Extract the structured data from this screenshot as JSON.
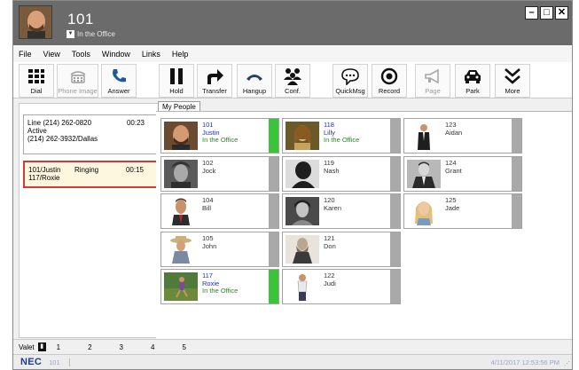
{
  "window": {
    "extension": "101",
    "status": "In the Office",
    "buttons": [
      "–",
      "□",
      "✕"
    ]
  },
  "menu": [
    "File",
    "View",
    "Tools",
    "Window",
    "Links",
    "Help"
  ],
  "toolbar": [
    {
      "label": "Dial",
      "icon": "dialpad-icon",
      "enabled": true
    },
    {
      "label": "Phone Image",
      "icon": "phone-image-icon",
      "enabled": false
    },
    {
      "label": "Answer",
      "icon": "answer-icon",
      "enabled": true
    },
    {
      "label": "Hold",
      "icon": "hold-icon",
      "enabled": true
    },
    {
      "label": "Transfer",
      "icon": "transfer-icon",
      "enabled": true
    },
    {
      "label": "Hangup",
      "icon": "hangup-icon",
      "enabled": true
    },
    {
      "label": "Conf.",
      "icon": "conference-icon",
      "enabled": true
    },
    {
      "label": "QuickMsg",
      "icon": "quickmsg-icon",
      "enabled": true
    },
    {
      "label": "Record",
      "icon": "record-icon",
      "enabled": true
    },
    {
      "label": "Page",
      "icon": "page-icon",
      "enabled": false
    },
    {
      "label": "Park",
      "icon": "park-icon",
      "enabled": true
    },
    {
      "label": "More",
      "icon": "more-icon",
      "enabled": true
    }
  ],
  "calls": {
    "active": {
      "line": "Line (214) 262-0820",
      "time": "00:23",
      "state": "Active",
      "caller": "(214) 262-3932/Dallas"
    },
    "ringing": {
      "from": "101/Justin",
      "state": "Ringing",
      "time": "00:15",
      "to": "117/Roxie"
    }
  },
  "tab": "My People",
  "contacts": [
    {
      "ext": "101",
      "name": "Justin",
      "status": "In the Office",
      "online": true,
      "bar": "green",
      "photo": "man-beard"
    },
    {
      "ext": "102",
      "name": "Jock",
      "status": "",
      "online": false,
      "bar": "gray",
      "photo": "bw-man"
    },
    {
      "ext": "104",
      "name": "Bill",
      "status": "",
      "online": false,
      "bar": "gray",
      "photo": "man-tie"
    },
    {
      "ext": "105",
      "name": "John",
      "status": "",
      "online": false,
      "bar": "gray",
      "photo": "cowboy"
    },
    {
      "ext": "117",
      "name": "Roxie",
      "status": "In the Office",
      "online": true,
      "bar": "green",
      "photo": "runner"
    },
    {
      "ext": "118",
      "name": "Lilly",
      "status": "In the Office",
      "online": true,
      "bar": "gray",
      "photo": "woman-painting"
    },
    {
      "ext": "119",
      "name": "Nash",
      "status": "",
      "online": false,
      "bar": "gray",
      "photo": "bw-silhouette"
    },
    {
      "ext": "120",
      "name": "Karen",
      "status": "",
      "online": false,
      "bar": "gray",
      "photo": "bw-woman"
    },
    {
      "ext": "121",
      "name": "Don",
      "status": "",
      "online": false,
      "bar": "gray",
      "photo": "bw-bearded"
    },
    {
      "ext": "122",
      "name": "Judi",
      "status": "",
      "online": false,
      "bar": "gray",
      "photo": "man-standing"
    },
    {
      "ext": "123",
      "name": "Aidan",
      "status": "",
      "online": false,
      "bar": "gray",
      "photo": "man-suit"
    },
    {
      "ext": "124",
      "name": "Grant",
      "status": "",
      "online": false,
      "bar": "gray",
      "photo": "bw-suit"
    },
    {
      "ext": "125",
      "name": "Jade",
      "status": "",
      "online": false,
      "bar": "gray",
      "photo": "woman-blonde"
    }
  ],
  "valet": {
    "label": "Valet",
    "slots": [
      "1",
      "2",
      "3",
      "4",
      "5"
    ]
  },
  "statusbar": {
    "brand": "NEC",
    "extension": "101",
    "datetime": "4/11/2017 12:53:56 PM"
  },
  "colors": {
    "titlebar": "#6b6b6b",
    "online_text": "#2233bb",
    "status_text": "#2a8a2a",
    "presence_green": "#39c43a",
    "ringing_border": "#d23a3a"
  }
}
